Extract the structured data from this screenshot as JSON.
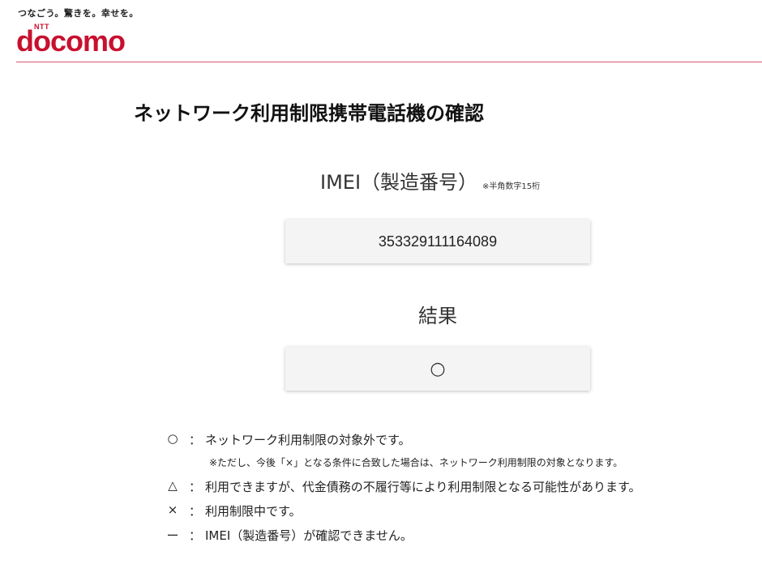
{
  "header": {
    "tagline": "つなごう。驚きを。幸せを。",
    "logo_small": "NTT",
    "logo_word": "docomo",
    "brand_color": "#c8102e"
  },
  "main": {
    "title": "ネットワーク利用制限携帯電話機の確認",
    "imei_label": "IMEI（製造番号）",
    "imei_note": "※半角数字15桁",
    "imei_value": "353329111164089",
    "result_label": "結果",
    "result_value": "○"
  },
  "legend": {
    "separator": "：",
    "items": [
      {
        "symbol": "○",
        "desc": "ネットワーク利用制限の対象外です。"
      },
      {
        "symbol": "△",
        "desc": "利用できますが、代金債務の不履行等により利用制限となる可能性があります。"
      },
      {
        "symbol": "×",
        "desc": "利用制限中です。"
      },
      {
        "symbol": "ー",
        "desc": "IMEI（製造番号）が確認できません。"
      }
    ],
    "note": "※ただし、今後「×」となる条件に合致した場合は、ネットワーク利用制限の対象となります。"
  }
}
